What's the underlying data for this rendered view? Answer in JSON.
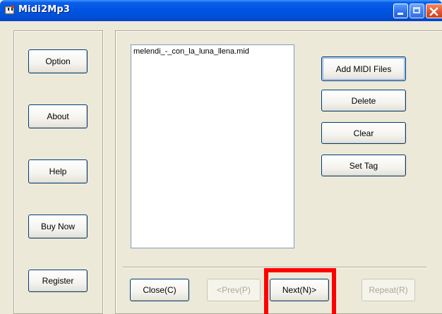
{
  "window": {
    "title": "Midi2Mp3"
  },
  "sidebar": {
    "buttons": [
      {
        "label": "Option"
      },
      {
        "label": "About"
      },
      {
        "label": "Help"
      },
      {
        "label": "Buy Now"
      },
      {
        "label": "Register"
      }
    ]
  },
  "file_list": {
    "items": [
      "melendi_-_con_la_luna_llena.mid"
    ]
  },
  "actions": {
    "add_label": "Add MIDI Files",
    "delete_label": "Delete",
    "clear_label": "Clear",
    "settag_label": "Set Tag"
  },
  "nav": {
    "close_label": "Close(C)",
    "prev_label": "<Prev(P)",
    "next_label": "Next(N)>",
    "repeat_label": "Repeat(R)"
  },
  "colors": {
    "titlebar": "#0054e3",
    "highlight": "#ff0000",
    "face": "#ece9d8"
  },
  "icons": {
    "app": "app-icon",
    "minimize": "minimize-icon",
    "maximize": "maximize-icon",
    "close": "close-icon"
  }
}
